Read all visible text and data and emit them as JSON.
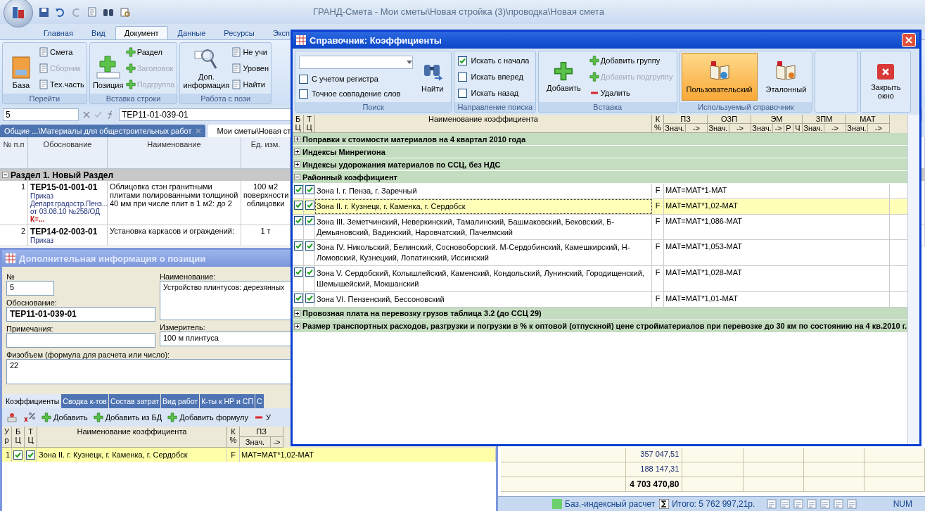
{
  "window": {
    "title": "ГРАНД-Смета - Мои сметы\\Новая стройка (3)\\проводка\\Новая смета"
  },
  "ribbon_tabs": [
    {
      "label": "Главная",
      "selected": false
    },
    {
      "label": "Вид",
      "selected": false
    },
    {
      "label": "Документ",
      "selected": true
    },
    {
      "label": "Данные",
      "selected": false
    },
    {
      "label": "Ресурсы",
      "selected": false
    },
    {
      "label": "Эксп",
      "selected": false
    }
  ],
  "ribbon_groups": [
    {
      "title": "Перейти",
      "large": [
        "База"
      ],
      "small": [
        {
          "label": "Смета",
          "disabled": false
        },
        {
          "label": "Сборник",
          "disabled": true
        },
        {
          "label": "Тех.часть",
          "disabled": false
        }
      ]
    },
    {
      "title": "Вставка строки",
      "large": [
        "Позиция"
      ],
      "small": [
        {
          "label": "Раздел",
          "disabled": false
        },
        {
          "label": "Заголовок",
          "disabled": true
        },
        {
          "label": "Подгруппа",
          "disabled": true
        }
      ]
    },
    {
      "title": "Работа с пози",
      "large": [
        "Доп. информация"
      ],
      "small": [
        {
          "label": "Не учи",
          "disabled": false
        },
        {
          "label": "Уровен",
          "disabled": false
        },
        {
          "label": "Найти",
          "disabled": false
        }
      ]
    }
  ],
  "formula_bar": {
    "cell": "5",
    "formula": "ТЕР11-01-039-01"
  },
  "doc_tabs": [
    {
      "label": "Общие ...\\Материалы для общестроительных работ",
      "selected": false
    },
    {
      "label": "Мои сметы\\Новая ст",
      "selected": true
    }
  ],
  "estimate": {
    "columns": [
      "№ п.п",
      "Обоснование",
      "Наименование",
      "Ед. изм."
    ],
    "section": {
      "title": "Раздел 1. Новый Раздел",
      "expanded": true
    },
    "rows": [
      {
        "num": "1",
        "code": "ТЕР15-01-001-01",
        "basis": [
          "Приказ",
          "Департ.градостр.Пенз...",
          "от 03.08.10 №258/ОД"
        ],
        "factor": "К=...",
        "name": "Облицовка стэн гранитными плитами полированными толщиной 40 мм при числе плит в 1 м2: до 2",
        "unit": "100 м2 поверхности облицовки"
      },
      {
        "num": "2",
        "code": "ТЕР14-02-003-01",
        "basis": [
          "Приказ"
        ],
        "name": "Установка каркасов и ограждений:",
        "unit": "1 т"
      }
    ],
    "totals": [
      {
        "value": "357 047,51",
        "bold": false
      },
      {
        "value": "188 147,31",
        "bold": false
      },
      {
        "value": "4 703 470,80",
        "bold": true
      }
    ]
  },
  "status_bar": {
    "mode": "Баз.-индексный расчет",
    "total": "Итого: 5 762 997,21р.",
    "indicator": "NUM"
  },
  "info_dialog": {
    "title": "Дополнительная информация о позиции",
    "number_label": "№",
    "number": "5",
    "basis_label": "Обоснование:",
    "basis": "ТЕР11-01-039-01",
    "name_label": "Наименование:",
    "name": "Устройство плинтусов: дерезянных",
    "notes_label": "Примечания:",
    "measure_label": "Измеритель:",
    "measure": "100 м плинтуса",
    "volume_label": "Физобъем (формула для расчета или число):",
    "volume": "22",
    "tabs": [
      {
        "label": "Коэффициенты",
        "selected": true
      },
      {
        "label": "Сводка к-тов",
        "selected": false
      },
      {
        "label": "Состав затрат",
        "selected": false
      },
      {
        "label": "Вид работ",
        "selected": false
      },
      {
        "label": "К-ты к НР и СП",
        "selected": false
      },
      {
        "label": "С",
        "selected": false
      }
    ],
    "toolbar": [
      "Добавить",
      "Добавить из БД",
      "Добавить формулу",
      "У"
    ],
    "columns": {
      "level": "У р",
      "bc": "Б Ц",
      "tc": "Т Ц",
      "name": "Наименование коэффициента",
      "k": "К %",
      "pz": "ПЗ",
      "value": "Знач.",
      "arrow": "->"
    },
    "rows": [
      {
        "level": "1",
        "bc": true,
        "tc": true,
        "name": "Зона II. г. Кузнецк, г. Каменка, г. Сердобск",
        "k": "F",
        "formula": "МАТ=МАТ*1,02-МАТ",
        "selected": true
      }
    ]
  },
  "ref_dialog": {
    "title": "Справочник: Коэффициенты",
    "search": {
      "title": "Поиск",
      "options": [
        {
          "label": "С учетом регистра",
          "checked": false
        },
        {
          "label": "Точное совпадение слов",
          "checked": false
        }
      ],
      "find": "Найти"
    },
    "direction": {
      "title": "Направление поиска",
      "options": [
        {
          "label": "Искать с начала",
          "checked": true
        },
        {
          "label": "Искать вперед",
          "checked": false
        },
        {
          "label": "Искать назад",
          "checked": false
        }
      ]
    },
    "insert": {
      "title": "Вставка",
      "add": "Добавить",
      "items": [
        {
          "label": "Добавить группу",
          "disabled": false
        },
        {
          "label": "Добавить подгруппу",
          "disabled": true
        },
        {
          "label": "Удалить",
          "disabled": false
        }
      ]
    },
    "reference": {
      "title": "Используемый справочник",
      "options": [
        {
          "label": "Пользовательский",
          "selected": true
        },
        {
          "label": "Эталонный",
          "selected": false
        }
      ]
    },
    "close": "Закрыть окно",
    "columns": {
      "bc": "Б Ц",
      "tc": "Т Ц",
      "name": "Наименование коэффициента",
      "k": "К %",
      "groups": [
        {
          "label": "ПЗ",
          "subs": [
            "Знач.",
            "->"
          ]
        },
        {
          "label": "ОЗП",
          "subs": [
            "Знач.",
            "->"
          ]
        },
        {
          "label": "ЭМ",
          "subs": [
            "Знач.",
            "->",
            "Р",
            "Ч"
          ]
        },
        {
          "label": "ЗПМ",
          "subs": [
            "Знач.",
            "->"
          ]
        },
        {
          "label": "МАТ",
          "subs": [
            "Знач.",
            "->"
          ]
        }
      ]
    },
    "groups": [
      {
        "name": "Поправки к стоимости материалов на 4 квартал 2010 года",
        "expanded": false
      },
      {
        "name": "Индексы Минрегиона",
        "expanded": false
      },
      {
        "name": "Индексы удорожания материалов по ССЦ, без НДС",
        "expanded": false
      },
      {
        "name": "Районный коэффициент",
        "expanded": true,
        "children": [
          {
            "name": "Зона I. г. Пенза, г. Заречный",
            "bc": true,
            "tc": true,
            "k": "F",
            "formula": "МАТ=МАТ*1-МАТ",
            "selected": false
          },
          {
            "name": "Зона II. г. Кузнецк, г. Каменка, г. Сердобск",
            "bc": true,
            "tc": true,
            "k": "F",
            "formula": "МАТ=МАТ*1,02-МАТ",
            "selected": true
          },
          {
            "name": "Зона III. Земетчинский, Неверкинский, Тамалинский, Башмаковский, Бековский, Б-Демьяновский, Вадинский, Наровчатский, Пачелмский",
            "bc": true,
            "tc": true,
            "k": "F",
            "formula": "МАТ=МАТ*1,086-МАТ",
            "selected": false
          },
          {
            "name": "Зона IV. Никольский, Белинский, Сосновоборский. М-Сердобинский, Камешкирский, Н-Ломовский, Кузнецкий, Лопатинский, Иссинский",
            "bc": true,
            "tc": true,
            "k": "F",
            "formula": "МАТ=МАТ*1,053-МАТ",
            "selected": false
          },
          {
            "name": "Зона V. Сердобский, Колышлейский, Каменский, Кондольский, Лунинский, Городищенский, Шемышейский, Мокшанский",
            "bc": true,
            "tc": true,
            "k": "F",
            "formula": "МАТ=МАТ*1,028-МАТ",
            "selected": false
          },
          {
            "name": "Зона VI. Пензенский, Бессоновский",
            "bc": true,
            "tc": true,
            "k": "F",
            "formula": "МАТ=МАТ*1,01-МАТ",
            "selected": false
          }
        ]
      },
      {
        "name": "Провозная плата на перевозку грузов таблица 3.2 (до ССЦ 29)",
        "expanded": false
      },
      {
        "name": "Размер транспортных расходов, разгрузки и погрузки в % к оптовой (отпускной) цене стройматериалов при перевозке до 30 км по состоянию на 4 кв.2010 г.",
        "expanded": false
      }
    ]
  }
}
